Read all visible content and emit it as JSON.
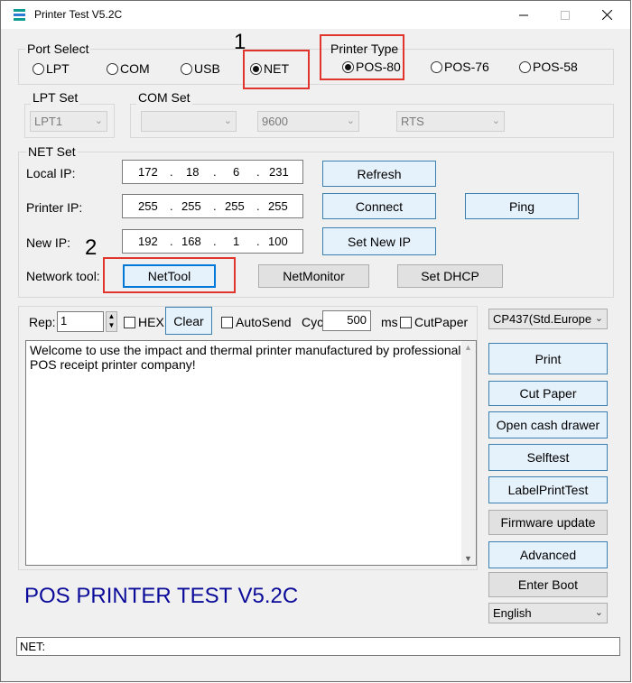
{
  "window": {
    "title": "Printer Test V5.2C"
  },
  "port_select": {
    "label": "Port Select",
    "options": [
      "LPT",
      "COM",
      "USB",
      "NET"
    ],
    "selected": "NET"
  },
  "printer_type": {
    "label": "Printer Type",
    "options": [
      "POS-80",
      "POS-76",
      "POS-58"
    ],
    "selected": "POS-80"
  },
  "lpt_set": {
    "label": "LPT Set",
    "port": "LPT1"
  },
  "com_set": {
    "label": "COM Set",
    "port": "",
    "baud": "9600",
    "flow": "RTS"
  },
  "net_set": {
    "label": "NET Set",
    "local_ip_label": "Local IP:",
    "local_ip": [
      "172",
      "18",
      "6",
      "231"
    ],
    "printer_ip_label": "Printer IP:",
    "printer_ip": [
      "255",
      "255",
      "255",
      "255"
    ],
    "new_ip_label": "New IP:",
    "new_ip": [
      "192",
      "168",
      "1",
      "100"
    ],
    "network_tool_label": "Network tool:",
    "dot": ".",
    "refresh": "Refresh",
    "connect": "Connect",
    "ping": "Ping",
    "set_new_ip": "Set New IP",
    "nettool": "NetTool",
    "netmonitor": "NetMonitor",
    "set_dhcp": "Set DHCP"
  },
  "annotations": {
    "marker1": "1",
    "marker2": "2"
  },
  "send": {
    "rep_label": "Rep:",
    "rep_value": "1",
    "hex_label": "HEX",
    "clear": "Clear",
    "autosend_label": "AutoSend",
    "cyc_label": "Cyc",
    "cyc_value": "500",
    "ms_label": "ms",
    "cutpaper_label": "CutPaper",
    "codepage": "CP437(Std.Europe"
  },
  "message": "Welcome to use the impact and thermal printer manufactured by professional POS receipt printer company!",
  "actions": {
    "print": "Print",
    "cut_paper": "Cut Paper",
    "open_cash_drawer": "Open cash drawer",
    "selftest": "Selftest",
    "label_print_test": "LabelPrintTest",
    "firmware_update": "Firmware update",
    "advanced": "Advanced",
    "enter_boot": "Enter Boot"
  },
  "language": "English",
  "banner": "POS PRINTER TEST V5.2C",
  "status": "NET:",
  "colors": {
    "banner": "#0b0b9a",
    "highlight_box": "#e0342d",
    "accent": "#0078d7"
  }
}
